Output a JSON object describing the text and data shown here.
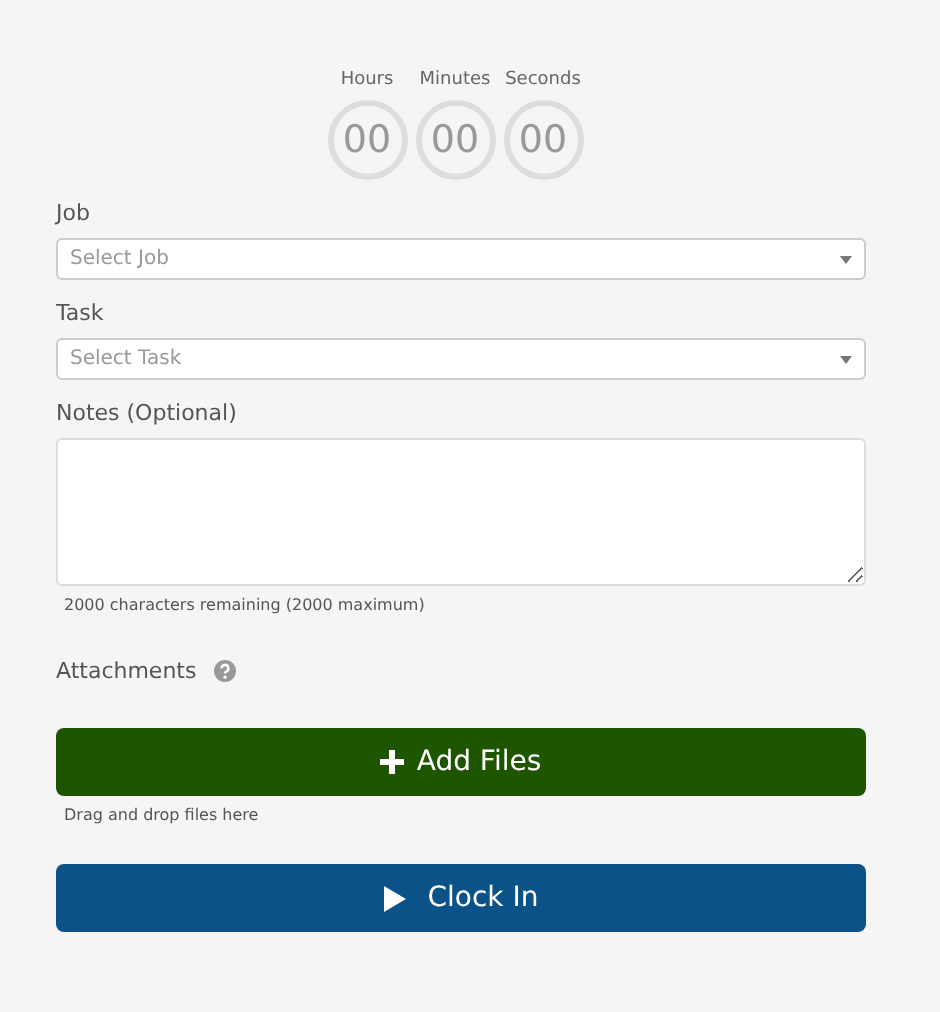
{
  "timer": [
    {
      "label": "Hours",
      "value": "00"
    },
    {
      "label": "Minutes",
      "value": "00"
    },
    {
      "label": "Seconds",
      "value": "00"
    }
  ],
  "job": {
    "label": "Job",
    "placeholder": "Select Job"
  },
  "task": {
    "label": "Task",
    "placeholder": "Select Task"
  },
  "notes": {
    "label": "Notes (Optional)",
    "counter": "2000 characters remaining (2000 maximum)"
  },
  "attachments": {
    "label": "Attachments",
    "button": "Add Files",
    "hint": "Drag and drop files here"
  },
  "clock_in": {
    "label": "Clock In"
  }
}
